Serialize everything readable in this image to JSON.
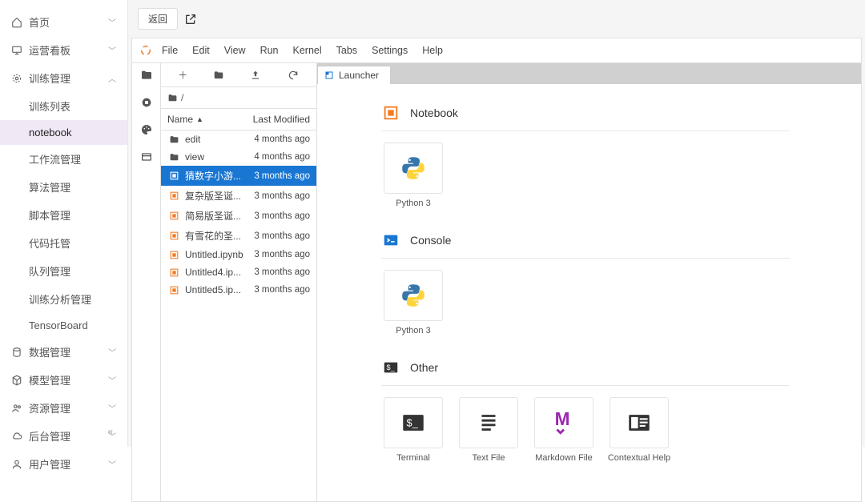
{
  "sidebar": {
    "items": [
      {
        "label": "首页",
        "icon": "home",
        "expandable": true
      },
      {
        "label": "运营看板",
        "icon": "monitor",
        "expandable": true
      },
      {
        "label": "训练管理",
        "icon": "gear-dot",
        "expandable": true,
        "open": true,
        "children": [
          {
            "label": "训练列表"
          },
          {
            "label": "notebook",
            "active": true
          },
          {
            "label": "工作流管理"
          },
          {
            "label": "算法管理"
          },
          {
            "label": "脚本管理"
          },
          {
            "label": "代码托管"
          },
          {
            "label": "队列管理"
          },
          {
            "label": "训练分析管理"
          },
          {
            "label": "TensorBoard"
          }
        ]
      },
      {
        "label": "数据管理",
        "icon": "data",
        "expandable": true
      },
      {
        "label": "模型管理",
        "icon": "cube",
        "expandable": true
      },
      {
        "label": "资源管理",
        "icon": "people",
        "expandable": true
      },
      {
        "label": "后台管理",
        "icon": "cloud",
        "expandable": true
      },
      {
        "label": "用户管理",
        "icon": "user",
        "expandable": true
      }
    ]
  },
  "toolbar": {
    "back_label": "返回"
  },
  "menubar": [
    "File",
    "Edit",
    "View",
    "Run",
    "Kernel",
    "Tabs",
    "Settings",
    "Help"
  ],
  "file_browser": {
    "path": "/",
    "columns": {
      "name": "Name",
      "modified": "Last Modified"
    },
    "entries": [
      {
        "name": "edit",
        "type": "folder",
        "modified": "4 months ago"
      },
      {
        "name": "view",
        "type": "folder",
        "modified": "4 months ago"
      },
      {
        "name": "猜数字小游...",
        "type": "notebook",
        "modified": "3 months ago",
        "selected": true
      },
      {
        "name": "复杂版圣诞...",
        "type": "notebook",
        "modified": "3 months ago"
      },
      {
        "name": "简易版圣诞...",
        "type": "notebook",
        "modified": "3 months ago"
      },
      {
        "name": "有雪花的圣...",
        "type": "notebook",
        "modified": "3 months ago"
      },
      {
        "name": "Untitled.ipynb",
        "type": "notebook",
        "modified": "3 months ago"
      },
      {
        "name": "Untitled4.ip...",
        "type": "notebook",
        "modified": "3 months ago"
      },
      {
        "name": "Untitled5.ip...",
        "type": "notebook",
        "modified": "3 months ago"
      }
    ]
  },
  "tab": {
    "title": "Launcher"
  },
  "launcher": {
    "sections": [
      {
        "title": "Notebook",
        "icon": "notebook",
        "cards": [
          {
            "label": "Python 3",
            "icon": "python"
          }
        ]
      },
      {
        "title": "Console",
        "icon": "console",
        "cards": [
          {
            "label": "Python 3",
            "icon": "python"
          }
        ]
      },
      {
        "title": "Other",
        "icon": "terminal",
        "cards": [
          {
            "label": "Terminal",
            "icon": "terminal"
          },
          {
            "label": "Text File",
            "icon": "textfile"
          },
          {
            "label": "Markdown File",
            "icon": "markdown"
          },
          {
            "label": "Contextual Help",
            "icon": "help"
          }
        ]
      }
    ]
  },
  "colors": {
    "accent": "#1976d2",
    "orange": "#f37b21",
    "purple": "#9c27b0"
  }
}
